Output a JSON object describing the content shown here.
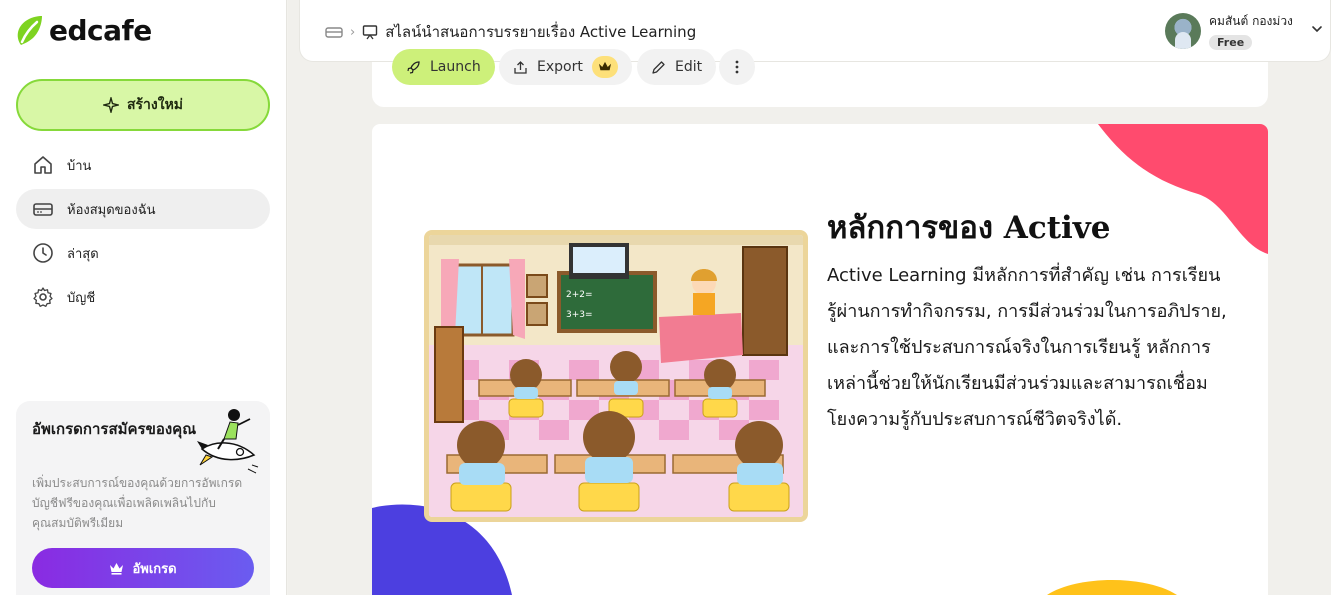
{
  "app": {
    "brand": "edcafe"
  },
  "sidebar": {
    "create_label": "สร้างใหม่",
    "items": [
      {
        "label": "บ้าน",
        "icon": "home-icon"
      },
      {
        "label": "ห้องสมุดของฉัน",
        "icon": "library-icon",
        "active": true
      },
      {
        "label": "ล่าสุด",
        "icon": "clock-icon"
      },
      {
        "label": "บัญชี",
        "icon": "gear-icon"
      }
    ],
    "upgrade": {
      "title": "อัพเกรดการสมัครของคุณ",
      "description": "เพิ่มประสบการณ์ของคุณด้วยการอัพเกรดบัญชีฟรีของคุณเพื่อเพลิดเพลินไปกับคุณสมบัติพรีเมียม",
      "button_label": "อัพเกรด"
    }
  },
  "header": {
    "breadcrumb_title": "สไลน์นำสนอการบรรยายเรื่อง Active Learning",
    "user_name": "คมสันต์ กองม่วง",
    "plan_badge": "Free"
  },
  "toolbar": {
    "launch_label": "Launch",
    "export_label": "Export",
    "edit_label": "Edit"
  },
  "slide": {
    "title": "หลักการของ Active",
    "body": "Active Learning มีหลักการที่สำคัญ เช่น การเรียนรู้ผ่านการทำกิจกรรม, การมีส่วนร่วมในการอภิปราย, และการใช้ประสบการณ์จริงในการเรียนรู้ หลักการเหล่านี้ช่วยให้นักเรียนมีส่วนร่วมและสามารถเชื่อมโยงความรู้กับประสบการณ์ชีวิตจริงได้.",
    "board_text_1": "2+2=",
    "board_text_2": "3+3="
  },
  "colors": {
    "accent_green": "#cdf07a",
    "upgrade_gradient_start": "#8a2be2",
    "upgrade_gradient_end": "#6a5cf0",
    "blob_pink": "#ff4b6e",
    "blob_blue": "#4c3fe0",
    "blob_yellow": "#ffc21a"
  }
}
